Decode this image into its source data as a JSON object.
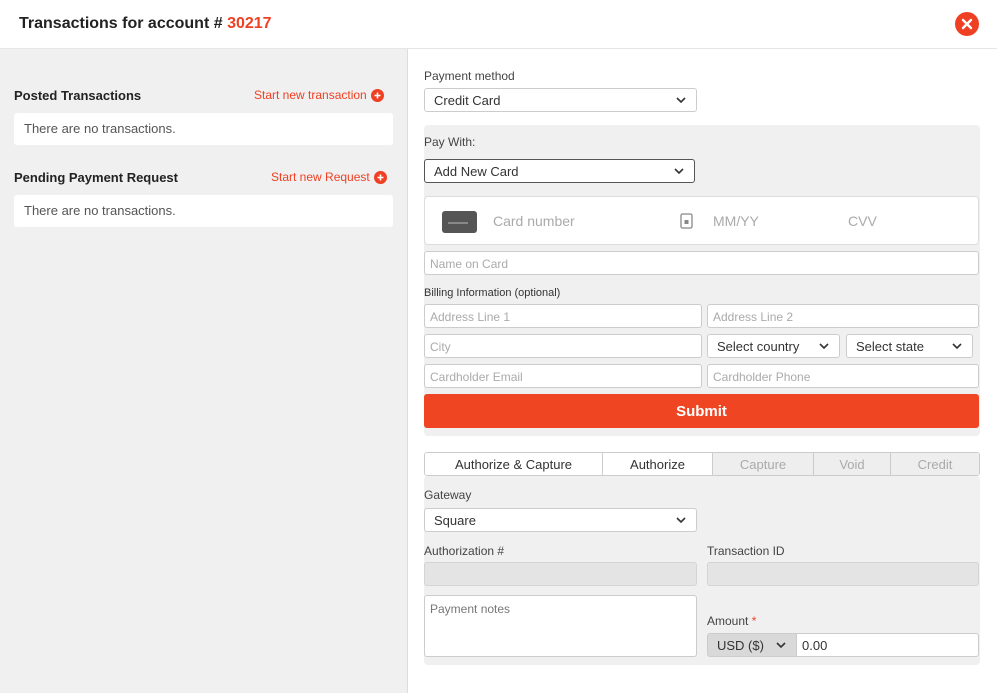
{
  "header": {
    "title_prefix": "Transactions for account # ",
    "account_number": "30217"
  },
  "left": {
    "posted": {
      "title": "Posted Transactions",
      "link": "Start new transaction",
      "empty": "There are no transactions."
    },
    "pending": {
      "title": "Pending Payment Request",
      "link": "Start new Request",
      "empty": "There are no transactions."
    }
  },
  "payment": {
    "method_label": "Payment method",
    "method_value": "Credit Card",
    "pay_with_label": "Pay With:",
    "pay_with_value": "Add New Card",
    "card": {
      "number_placeholder": "Card number",
      "expiry_placeholder": "MM/YY",
      "cvv_placeholder": "CVV"
    },
    "name_on_card_placeholder": "Name on Card",
    "billing_label": "Billing Information (optional)",
    "address1_placeholder": "Address Line 1",
    "address2_placeholder": "Address Line 2",
    "city_placeholder": "City",
    "country_value": "Select country",
    "state_value": "Select state",
    "email_placeholder": "Cardholder Email",
    "phone_placeholder": "Cardholder Phone",
    "submit_label": "Submit"
  },
  "tabs": [
    {
      "label": "Authorize & Capture",
      "enabled": true
    },
    {
      "label": "Authorize",
      "enabled": true
    },
    {
      "label": "Capture",
      "enabled": false
    },
    {
      "label": "Void",
      "enabled": false
    },
    {
      "label": "Credit",
      "enabled": false
    }
  ],
  "gateway": {
    "label": "Gateway",
    "value": "Square",
    "auth_label": "Authorization #",
    "txn_label": "Transaction ID",
    "notes_placeholder": "Payment notes",
    "amount_label": "Amount",
    "required_mark": "*",
    "currency_value": "USD ($)",
    "amount_value": "0.00"
  },
  "colors": {
    "accent": "#ef4023",
    "submit": "#f04523"
  }
}
